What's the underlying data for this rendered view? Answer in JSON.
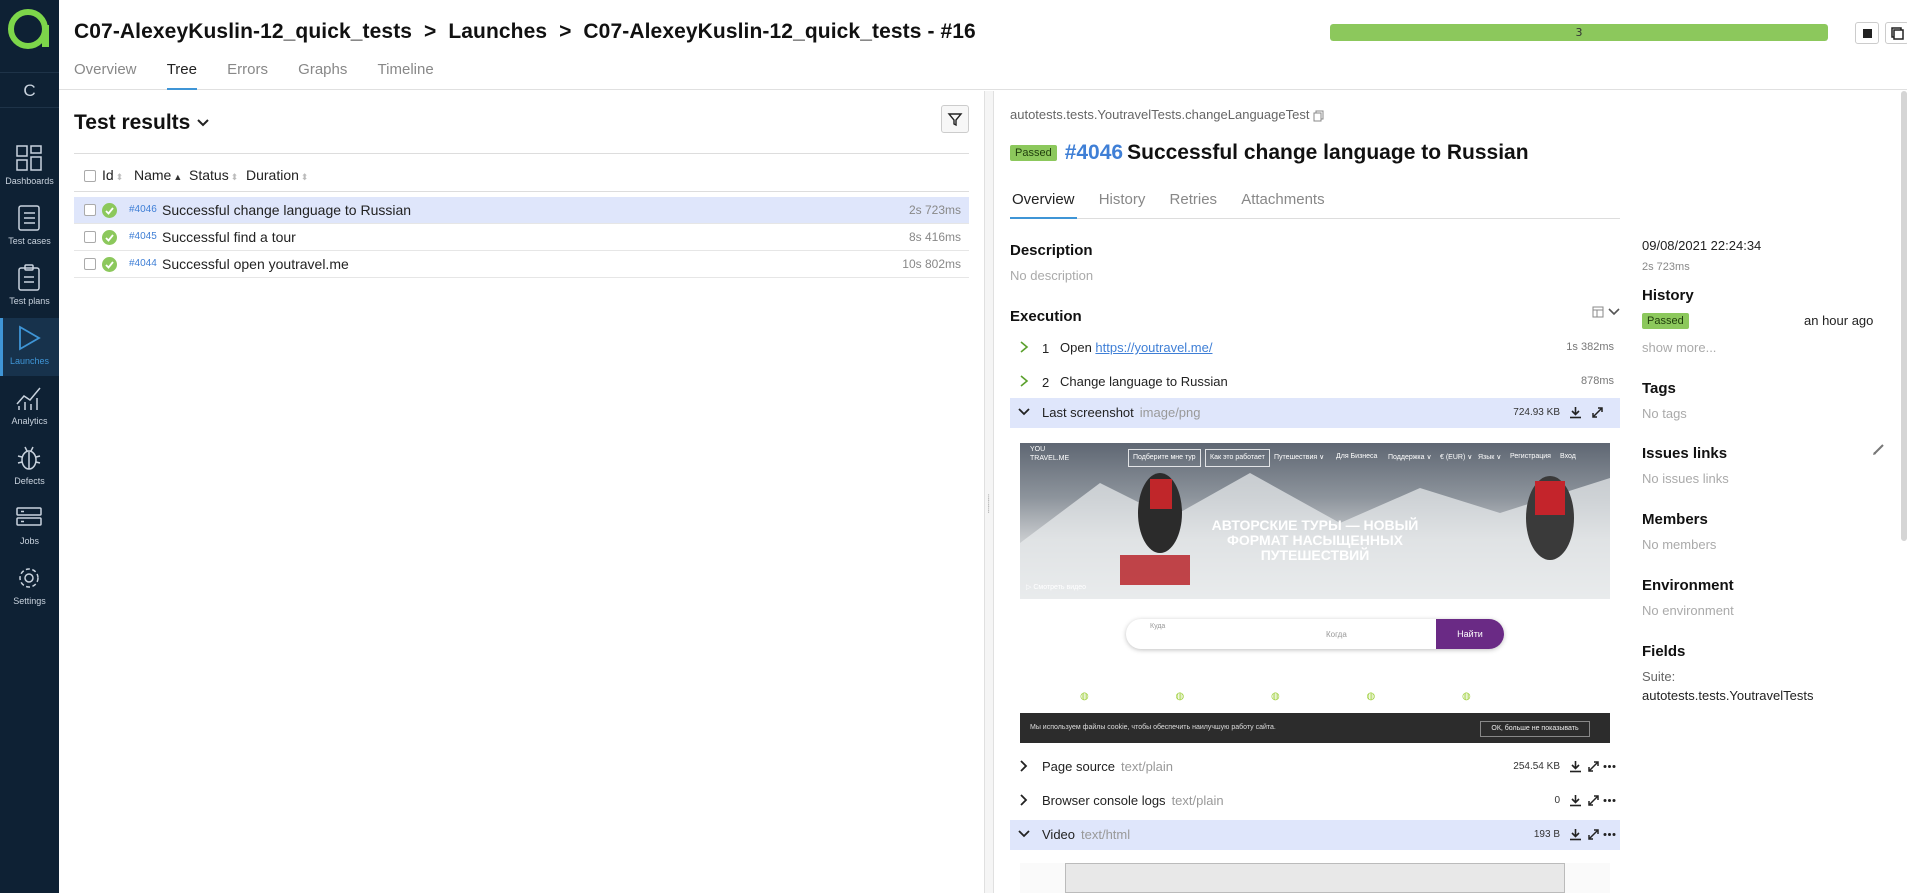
{
  "sidebar": {
    "collapse_label": "C",
    "items": [
      {
        "label": "Dashboards",
        "icon": "dashboards-icon"
      },
      {
        "label": "Test cases",
        "icon": "test-cases-icon"
      },
      {
        "label": "Test plans",
        "icon": "test-plans-icon"
      },
      {
        "label": "Launches",
        "icon": "launches-icon",
        "active": true
      },
      {
        "label": "Analytics",
        "icon": "analytics-icon"
      },
      {
        "label": "Defects",
        "icon": "defects-icon"
      },
      {
        "label": "Jobs",
        "icon": "jobs-icon"
      },
      {
        "label": "Settings",
        "icon": "settings-icon"
      }
    ]
  },
  "header": {
    "breadcrumb": [
      "C07-AlexeyKuslin-12_quick_tests",
      ">",
      "Launches",
      ">",
      "C07-AlexeyKuslin-12_quick_tests - #16"
    ],
    "tabs": [
      "Overview",
      "Tree",
      "Errors",
      "Graphs",
      "Timeline"
    ],
    "active_tab": "Tree",
    "progress_count": "3",
    "progress_fraction": 1.0,
    "progress_color": "#8cc85c"
  },
  "tree": {
    "title": "Test results",
    "columns": [
      "Id",
      "Name",
      "Status",
      "Duration"
    ],
    "rows": [
      {
        "id": "#4046",
        "name": "Successful change language to Russian",
        "duration": "2s 723ms",
        "selected": true
      },
      {
        "id": "#4045",
        "name": "Successful find a tour",
        "duration": "8s 416ms"
      },
      {
        "id": "#4044",
        "name": "Successful open youtravel.me",
        "duration": "10s 802ms"
      }
    ]
  },
  "detail": {
    "full_name": "autotests.tests.YoutravelTests.changeLanguageTest",
    "status": "Passed",
    "test_id": "#4046",
    "title": "Successful change language to Russian",
    "tabs": [
      "Overview",
      "History",
      "Retries",
      "Attachments"
    ],
    "description_label": "Description",
    "description_value": "No description",
    "execution_label": "Execution",
    "steps": [
      {
        "num": "1",
        "text": "Open ",
        "link": "https://youtravel.me/",
        "time": "1s 382ms"
      },
      {
        "num": "2",
        "text": "Change language to Russian",
        "link": "",
        "time": "878ms"
      }
    ],
    "attachments": [
      {
        "name": "Last screenshot",
        "type": "image/png",
        "size": "724.93 KB"
      },
      {
        "name": "Page source",
        "type": "text/plain",
        "size": "254.54 KB"
      },
      {
        "name": "Browser console logs",
        "type": "text/plain",
        "size": "0"
      },
      {
        "name": "Video",
        "type": "text/html",
        "size": "193 B"
      }
    ],
    "screenshot": {
      "brand_top": "YOU",
      "brand_bottom": "TRAVEL.ME",
      "nav_box1": "Подберите мне тур",
      "nav_box2": "Как это работает",
      "nav_items": [
        "Путешествия ∨",
        "Для Бизнеса",
        "Поддержка ∨",
        "€ (EUR) ∨",
        "Язык ∨",
        "Регистрация",
        "Вход"
      ],
      "hero": "АВТОРСКИЕ ТУРЫ — НОВЫЙ ФОРМАТ НАСЫЩЕННЫХ ПУТЕШЕСТВИЙ",
      "watch_video": "Смотреть видео",
      "where_label": "Куда",
      "when_label": "Когда",
      "find_button": "Найти",
      "cookie_text": "Мы используем файлы cookie, чтобы обеспечить наилучшую работу сайта.",
      "cookie_ok": "ОК, больше не показывать"
    }
  },
  "side": {
    "started": "09/08/2021 22:24:34",
    "duration": "2s 723ms",
    "history_label": "History",
    "history_status": "Passed",
    "history_when": "an hour ago",
    "show_more": "show more...",
    "tags_label": "Tags",
    "tags_value": "No tags",
    "issues_label": "Issues links",
    "issues_value": "No issues links",
    "members_label": "Members",
    "members_value": "No members",
    "environment_label": "Environment",
    "environment_value": "No environment",
    "fields_label": "Fields",
    "suite_label": "Suite:",
    "suite_value": "autotests.tests.YoutravelTests"
  },
  "colors": {
    "sidebar_bg": "#0e2134",
    "accent": "#3f95d6",
    "passed": "#8cc85c",
    "link": "#3f7fd6",
    "selected_row": "#dfe6fb"
  }
}
